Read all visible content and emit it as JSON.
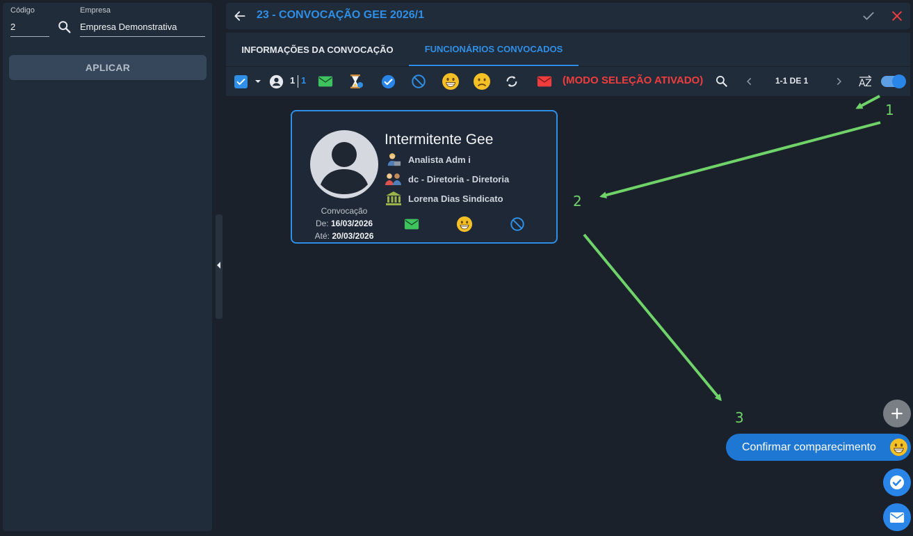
{
  "filters": {
    "codigo_label": "Código",
    "codigo_value": "2",
    "empresa_label": "Empresa",
    "empresa_value": "Empresa Demonstrativa",
    "apply_label": "APLICAR"
  },
  "header": {
    "title": "23 - CONVOCAÇÃO GEE 2026/1"
  },
  "tabs": [
    {
      "label": "INFORMAÇÕES DA CONVOCAÇÃO"
    },
    {
      "label": "FUNCIONÁRIOS CONVOCADOS"
    }
  ],
  "toolbar": {
    "selected_count": "1",
    "total_count": "1",
    "mode_label": "(MODO SELEÇÃO ATIVADO)",
    "pager": "1-1 DE 1",
    "sort_icon": "sort-az-icon",
    "selection_mode_on": true
  },
  "card": {
    "name": "Intermitente Gee",
    "role": "Analista Adm i",
    "department": "dc - Diretoria - Diretoria",
    "union": "Lorena Dias Sindicato",
    "convocacao_label": "Convocação",
    "de_label": "De:",
    "de_value": "16/03/2026",
    "ate_label": "Até:",
    "ate_value": "20/03/2026"
  },
  "annotations": [
    "1",
    "2",
    "3"
  ],
  "fab": {
    "confirm_label": "Confirmar comparecimento"
  },
  "colors": {
    "accent": "#2f8fe6",
    "danger": "#ef3d3d",
    "success": "#3ec35f",
    "annotation": "#6fd36a"
  }
}
